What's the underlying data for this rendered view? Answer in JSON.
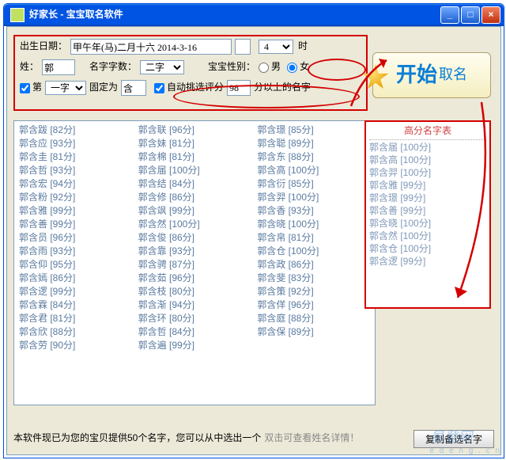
{
  "window": {
    "title": "好家长 - 宝宝取名软件"
  },
  "controls": {
    "birth_label": "出生日期：",
    "birth_value": "甲午年(马)二月十六 2014-3-16",
    "hour_value": "4",
    "hour_unit": "时",
    "surname_label": "姓：",
    "surname_value": "郭",
    "charcount_label": "名字字数：",
    "charcount_value": "二字",
    "gender_label": "宝宝性别：",
    "gender_male": "男",
    "gender_female": "女",
    "first_char_chk": "第",
    "first_char_sel": "一字",
    "fixed_label": "固定为",
    "fixed_value": "含",
    "auto_chk": "自动挑选评分",
    "auto_score": "98",
    "auto_tail": "分以上的名字",
    "start1": "开始",
    "start2": "取名"
  },
  "names": [
    {
      "n": "郭含跋",
      "s": "82分"
    },
    {
      "n": "郭含应",
      "s": "93分"
    },
    {
      "n": "郭含圭",
      "s": "81分"
    },
    {
      "n": "郭含哲",
      "s": "93分"
    },
    {
      "n": "郭含宏",
      "s": "94分"
    },
    {
      "n": "郭含粉",
      "s": "92分"
    },
    {
      "n": "郭含雅",
      "s": "99分"
    },
    {
      "n": "郭含善",
      "s": "99分"
    },
    {
      "n": "郭含员",
      "s": "96分"
    },
    {
      "n": "郭含雨",
      "s": "93分"
    },
    {
      "n": "郭含仰",
      "s": "95分"
    },
    {
      "n": "郭含嫣",
      "s": "86分"
    },
    {
      "n": "郭含逻",
      "s": "99分"
    },
    {
      "n": "郭含霖",
      "s": "84分"
    },
    {
      "n": "郭含君",
      "s": "81分"
    },
    {
      "n": "郭含欣",
      "s": "88分"
    },
    {
      "n": "郭含劳",
      "s": "90分"
    },
    {
      "n": "郭含联",
      "s": "96分"
    },
    {
      "n": "郭含妹",
      "s": "81分"
    },
    {
      "n": "郭含棉",
      "s": "81分"
    },
    {
      "n": "郭含届",
      "s": "100分"
    },
    {
      "n": "郭含结",
      "s": "84分"
    },
    {
      "n": "郭含修",
      "s": "86分"
    },
    {
      "n": "郭含飒",
      "s": "99分"
    },
    {
      "n": "郭含然",
      "s": "100分"
    },
    {
      "n": "郭含俊",
      "s": "86分"
    },
    {
      "n": "郭含靠",
      "s": "93分"
    },
    {
      "n": "郭含骋",
      "s": "87分"
    },
    {
      "n": "郭含茹",
      "s": "96分"
    },
    {
      "n": "郭含枝",
      "s": "80分"
    },
    {
      "n": "郭含渐",
      "s": "94分"
    },
    {
      "n": "郭含环",
      "s": "80分"
    },
    {
      "n": "郭含哲",
      "s": "84分"
    },
    {
      "n": "郭含遍",
      "s": "99分"
    },
    {
      "n": "郭含璟",
      "s": "85分"
    },
    {
      "n": "郭含聪",
      "s": "89分"
    },
    {
      "n": "郭含东",
      "s": "88分"
    },
    {
      "n": "郭含高",
      "s": "100分"
    },
    {
      "n": "郭含衍",
      "s": "85分"
    },
    {
      "n": "郭含羿",
      "s": "100分"
    },
    {
      "n": "郭含香",
      "s": "93分"
    },
    {
      "n": "郭含晓",
      "s": "100分"
    },
    {
      "n": "郭含帛",
      "s": "81分"
    },
    {
      "n": "郭含仓",
      "s": "100分"
    },
    {
      "n": "郭含政",
      "s": "86分"
    },
    {
      "n": "郭含斐",
      "s": "83分"
    },
    {
      "n": "郭含策",
      "s": "92分"
    },
    {
      "n": "郭含佯",
      "s": "96分"
    },
    {
      "n": "郭含庭",
      "s": "88分"
    },
    {
      "n": "郭含保",
      "s": "89分"
    }
  ],
  "high": {
    "header": "高分名字表",
    "items": [
      {
        "n": "郭含届",
        "s": "100分"
      },
      {
        "n": "郭含高",
        "s": "100分"
      },
      {
        "n": "郭含羿",
        "s": "100分"
      },
      {
        "n": "郭含雅",
        "s": "99分"
      },
      {
        "n": "郭含璟",
        "s": "99分"
      },
      {
        "n": "郭含善",
        "s": "99分"
      },
      {
        "n": "郭含晓",
        "s": "100分"
      },
      {
        "n": "郭含然",
        "s": "100分"
      },
      {
        "n": "郭含仓",
        "s": "100分"
      },
      {
        "n": "郭含逻",
        "s": "99分"
      }
    ]
  },
  "bottom": {
    "msg": "本软件现已为您的宝贝提供50个名字，您可以从中选出一个",
    "hint": "双击可查看姓名详情！",
    "copy": "复制备选名字"
  },
  "watermark": {
    "brand": "易登网",
    "url": "e d e n g . c n"
  }
}
